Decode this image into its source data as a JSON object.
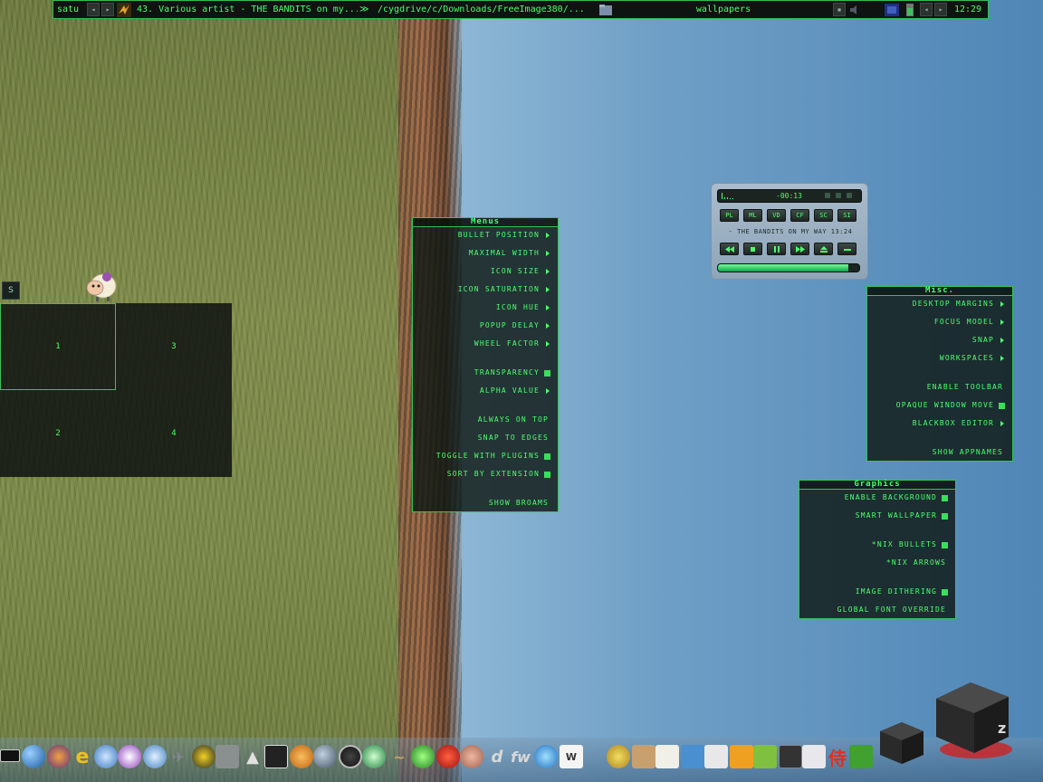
{
  "toolbar": {
    "workspace": "satu",
    "window_title": "43. Various artist - THE BANDITS on my...",
    "path_title": "/cygdrive/c/Downloads/FreeImage380/...",
    "current_label": "wallpapers",
    "clock": "12:29"
  },
  "menus": {
    "menus": {
      "title": "Menus",
      "items": [
        {
          "label": "Bullet Position",
          "type": "arrow"
        },
        {
          "label": "Maximal Width",
          "type": "arrow"
        },
        {
          "label": "Icon Size",
          "type": "arrow"
        },
        {
          "label": "Icon Saturation",
          "type": "arrow"
        },
        {
          "label": "Icon Hue",
          "type": "arrow"
        },
        {
          "label": "Popup Delay",
          "type": "arrow"
        },
        {
          "label": "Wheel Factor",
          "type": "arrow"
        },
        {
          "label": "Transparency",
          "type": "check"
        },
        {
          "label": "Alpha Value",
          "type": "arrow"
        },
        {
          "label": "Always On Top",
          "type": "none"
        },
        {
          "label": "Snap To Edges",
          "type": "none"
        },
        {
          "label": "Toggle With Plugins",
          "type": "check"
        },
        {
          "label": "Sort By Extension",
          "type": "check"
        },
        {
          "label": "Show Broams",
          "type": "none"
        }
      ]
    },
    "misc": {
      "title": "Misc.",
      "items": [
        {
          "label": "Desktop Margins",
          "type": "arrow"
        },
        {
          "label": "Focus Model",
          "type": "arrow"
        },
        {
          "label": "Snap",
          "type": "arrow"
        },
        {
          "label": "Workspaces",
          "type": "arrow"
        },
        {
          "label": "Enable Toolbar",
          "type": "none"
        },
        {
          "label": "Opaque Window Move",
          "type": "check"
        },
        {
          "label": "Blackbox Editor",
          "type": "arrow"
        },
        {
          "label": "Show Appnames",
          "type": "none"
        }
      ]
    },
    "graphics": {
      "title": "Graphics",
      "items": [
        {
          "label": "Enable Background",
          "type": "check"
        },
        {
          "label": "Smart Wallpaper",
          "type": "check"
        },
        {
          "label": "*nix Bullets",
          "type": "check"
        },
        {
          "label": "*nix Arrows",
          "type": "none"
        },
        {
          "label": "Image Dithering",
          "type": "check"
        },
        {
          "label": "Global Font Override",
          "type": "none"
        }
      ]
    }
  },
  "pager": {
    "button": "S",
    "workspaces": [
      "1",
      "2",
      "3",
      "4"
    ],
    "active": "1"
  },
  "player": {
    "time": "-00:13",
    "buttons": [
      "PL",
      "ML",
      "VD",
      "CF",
      "SC",
      "SI"
    ],
    "track": "- THE BANDITS ON MY WAY 13:24",
    "progress": 0.92
  },
  "colors": {
    "accent": "#4dff6e",
    "border": "#33c35a",
    "panel": "#0f1814"
  }
}
